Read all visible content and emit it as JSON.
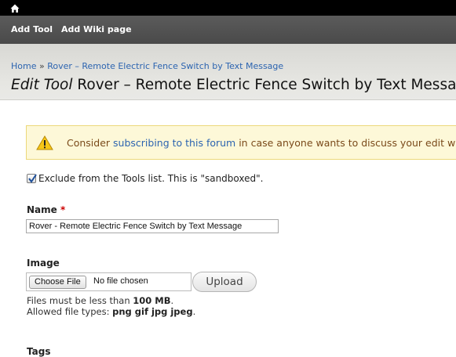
{
  "toolbar": {
    "home_icon": "home-icon",
    "add_tool": "Add Tool",
    "add_wiki": "Add Wiki page"
  },
  "breadcrumb": {
    "home": "Home",
    "separator": "»",
    "current": "Rover – Remote Electric Fence Switch by Text Message"
  },
  "page_title": {
    "prefix": "Edit Tool",
    "name": "Rover – Remote Electric Fence Switch by Text Message"
  },
  "warning": {
    "icon": "warning-icon",
    "before": "Consider ",
    "link": "subscribing to this forum",
    "after": " in case anyone wants to discuss your edit w"
  },
  "exclude": {
    "checked": true,
    "label": "Exclude from the Tools list. This is \"sandboxed\"."
  },
  "name_field": {
    "label": "Name",
    "required_marker": "*",
    "value": "Rover - Remote Electric Fence Switch by Text Message"
  },
  "image_field": {
    "label": "Image",
    "choose_label": "Choose File",
    "no_file": "No file chosen",
    "upload_label": "Upload",
    "size_prefix": "Files must be less than ",
    "size_value": "100 MB",
    "size_suffix": ".",
    "types_prefix": "Allowed file types: ",
    "types_value": "png gif jpg jpeg",
    "types_suffix": "."
  },
  "tags_field": {
    "label": "Tags"
  },
  "colors": {
    "link": "#2c64b0",
    "warning_bg": "#fdf8d8",
    "warning_text": "#7a4a1a",
    "required": "#cc0000"
  }
}
